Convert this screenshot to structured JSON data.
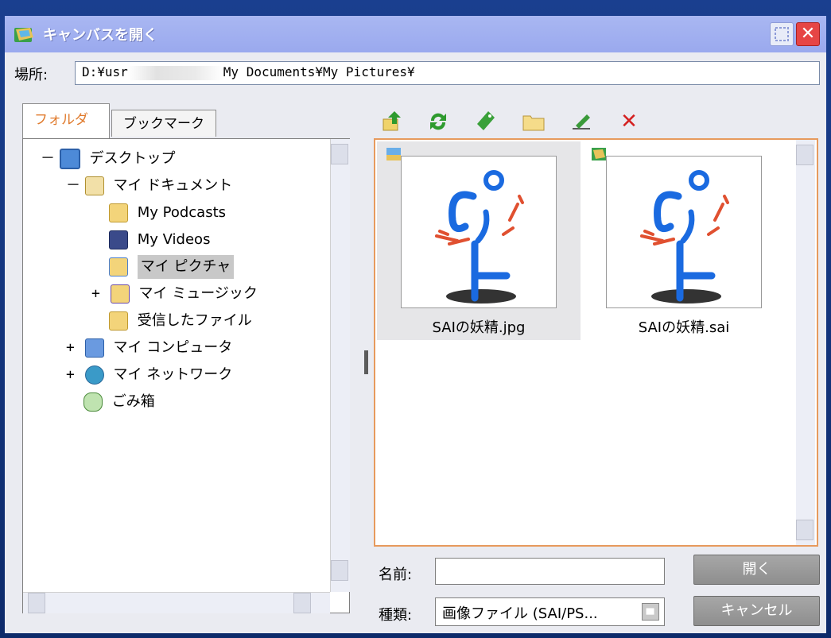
{
  "window": {
    "title": "キャンバスを開く"
  },
  "location": {
    "label": "場所:",
    "path_start": "D:¥usr",
    "path_end": "My Documents¥My Pictures¥"
  },
  "tabs": [
    {
      "label": "フォルダ",
      "active": true
    },
    {
      "label": "ブックマーク",
      "active": false
    }
  ],
  "tree": [
    {
      "label": "デスクトップ",
      "expander": "－",
      "icon": "desktop-icon",
      "selected": false
    },
    {
      "label": "マイ ドキュメント",
      "expander": "－",
      "icon": "my-documents-icon",
      "selected": false
    },
    {
      "label": "My Podcasts",
      "expander": "",
      "icon": "folder-icon",
      "selected": false
    },
    {
      "label": "My Videos",
      "expander": "",
      "icon": "videos-folder-icon",
      "selected": false
    },
    {
      "label": "マイ ピクチャ",
      "expander": "",
      "icon": "pictures-folder-icon",
      "selected": true
    },
    {
      "label": "マイ ミュージック",
      "expander": "+",
      "icon": "music-folder-icon",
      "selected": false
    },
    {
      "label": "受信したファイル",
      "expander": "",
      "icon": "folder-icon",
      "selected": false
    },
    {
      "label": "マイ コンピュータ",
      "expander": "+",
      "icon": "computer-icon",
      "selected": false
    },
    {
      "label": "マイ ネットワーク",
      "expander": "+",
      "icon": "network-icon",
      "selected": false
    },
    {
      "label": "ごみ箱",
      "expander": "",
      "icon": "recycle-bin-icon",
      "selected": false
    }
  ],
  "toolbar": [
    {
      "name": "up-folder-icon",
      "glyph": "⇧",
      "color": "#2e8b2e"
    },
    {
      "name": "refresh-icon",
      "glyph": "↻",
      "color": "#2e8b2e"
    },
    {
      "name": "bookmark-icon",
      "glyph": "◆",
      "color": "#3a9a3a"
    },
    {
      "name": "new-folder-icon",
      "glyph": "▭",
      "color": "#c9a24a"
    },
    {
      "name": "rename-icon",
      "glyph": "✎",
      "color": "#3a7a3a"
    },
    {
      "name": "delete-icon",
      "glyph": "✕",
      "color": "#d42020"
    }
  ],
  "files": [
    {
      "name": "SAIの妖精.jpg",
      "type": "jpg",
      "selected": true
    },
    {
      "name": "SAIの妖精.sai",
      "type": "sai",
      "selected": false
    }
  ],
  "filename": {
    "label": "名前:",
    "value": ""
  },
  "filetype": {
    "label": "種類:",
    "value": "画像ファイル (SAI/PS..."
  },
  "buttons": {
    "open": "開く",
    "cancel": "キャンセル"
  },
  "colors": {
    "titlebar": "#9aa9ee",
    "accent": "#e79a5d",
    "close": "#e64545"
  }
}
